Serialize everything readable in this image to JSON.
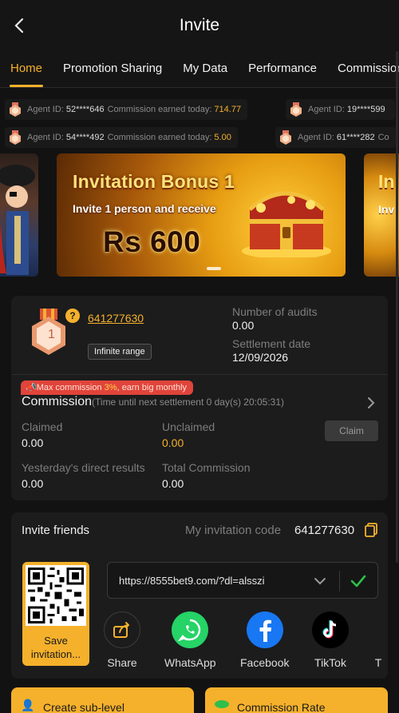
{
  "header": {
    "title": "Invite"
  },
  "tabs": [
    "Home",
    "Promotion Sharing",
    "My Data",
    "Performance",
    "Commission"
  ],
  "ticker": [
    {
      "label": "Agent ID:",
      "id": "52****646",
      "commission_label": "Commission earned today:",
      "amount": "714.77"
    },
    {
      "label": "Agent ID:",
      "id": "19****599",
      "commission_label": "",
      "amount": ""
    },
    {
      "label": "Agent ID:",
      "id": "54****492",
      "commission_label": "Commission earned today:",
      "amount": "5.00"
    },
    {
      "label": "Agent ID:",
      "id": "61****282",
      "commission_label": "Co",
      "amount": ""
    }
  ],
  "banner": {
    "title": "Invitation Bonus 1",
    "subtitle": "Invite 1 person and receive",
    "amount": "Rs 600",
    "right_peek_title": "In",
    "right_peek_sub": "Inv"
  },
  "agent": {
    "rank": "1",
    "id": "641277630",
    "range": "Infinite range",
    "audits_label": "Number of audits",
    "audits_value": "0.00",
    "settlement_label": "Settlement date",
    "settlement_value": "12/09/2026"
  },
  "commission": {
    "badge_prefix": "Max commission ",
    "badge_pct": "3%",
    "badge_suffix": ", earn big monthly",
    "title": "Commission",
    "subtitle": "(Time until next settlement  0 day(s) 20:05:31)",
    "claimed_label": "Claimed",
    "claimed_value": "0.00",
    "unclaimed_label": "Unclaimed",
    "unclaimed_value": "0.00",
    "claim_button": "Claim",
    "yesterday_label": "Yesterday's direct results",
    "yesterday_value": "0.00",
    "total_label": "Total Commission",
    "total_value": "0.00"
  },
  "invite": {
    "title": "Invite friends",
    "code_label": "My invitation code",
    "code": "641277630",
    "qr_label_1": "Save",
    "qr_label_2": "invitation...",
    "url": "https://8555bet9.com/?dl=alsszi",
    "share": [
      "Share",
      "WhatsApp",
      "Facebook",
      "TikTok",
      "T"
    ]
  },
  "bottom": {
    "left": "Create sub-level",
    "right": "Commission Rate"
  },
  "colors": {
    "accent": "#f5b12c",
    "background": "#121212",
    "card": "#1c1c1c",
    "badge": "#e0443a",
    "check": "#2fbf4a"
  }
}
